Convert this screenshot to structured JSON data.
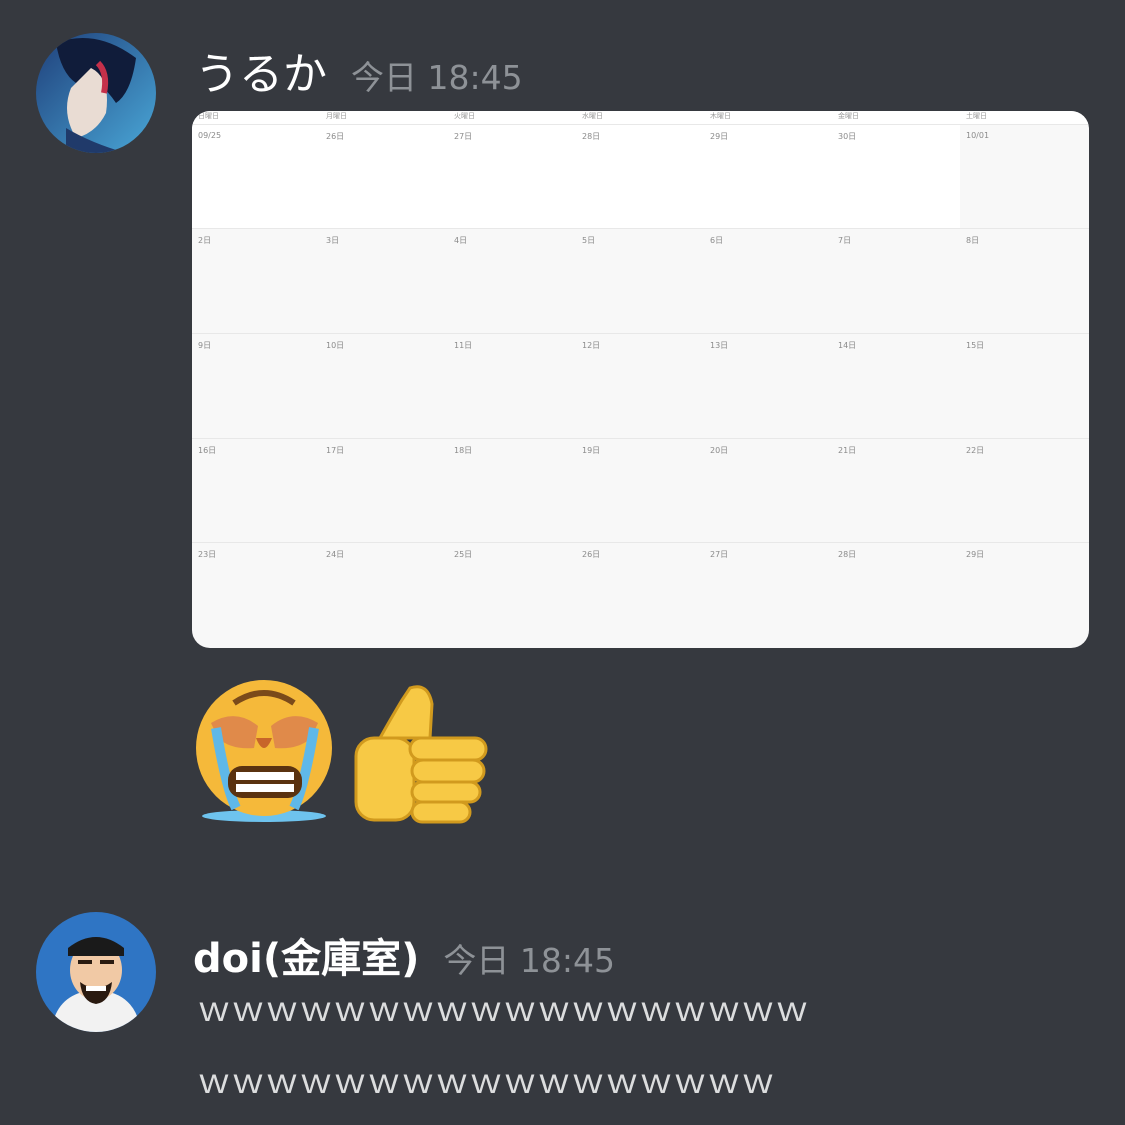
{
  "messages": [
    {
      "username": "うるか",
      "timestamp": "今日 18:45",
      "avatar_icon": "anime-character-avatar-icon",
      "attachment": {
        "type": "calendar-image",
        "weekdays": [
          "日曜日",
          "月曜日",
          "火曜日",
          "水曜日",
          "木曜日",
          "金曜日",
          "土曜日"
        ],
        "weeks": [
          [
            "09/25",
            "26日",
            "27日",
            "28日",
            "29日",
            "30日",
            "10/01"
          ],
          [
            "2日",
            "3日",
            "4日",
            "5日",
            "6日",
            "7日",
            "8日"
          ],
          [
            "9日",
            "10日",
            "11日",
            "12日",
            "13日",
            "14日",
            "15日"
          ],
          [
            "16日",
            "17日",
            "18日",
            "19日",
            "20日",
            "21日",
            "22日"
          ],
          [
            "23日",
            "24日",
            "25日",
            "26日",
            "27日",
            "28日",
            "29日"
          ]
        ]
      },
      "emojis": [
        "loudly-crying-face-emoji",
        "thumbs-up-emoji"
      ]
    },
    {
      "username": "doi(金庫室)",
      "timestamp": "今日 18:45",
      "avatar_icon": "illustrated-man-avatar-icon",
      "lines": [
        "ｗｗｗｗｗｗｗｗｗｗｗｗｗｗｗｗｗｗ",
        "ｗｗｗｗｗｗｗｗｗｗｗｗｗｗｗｗｗ"
      ]
    }
  ]
}
